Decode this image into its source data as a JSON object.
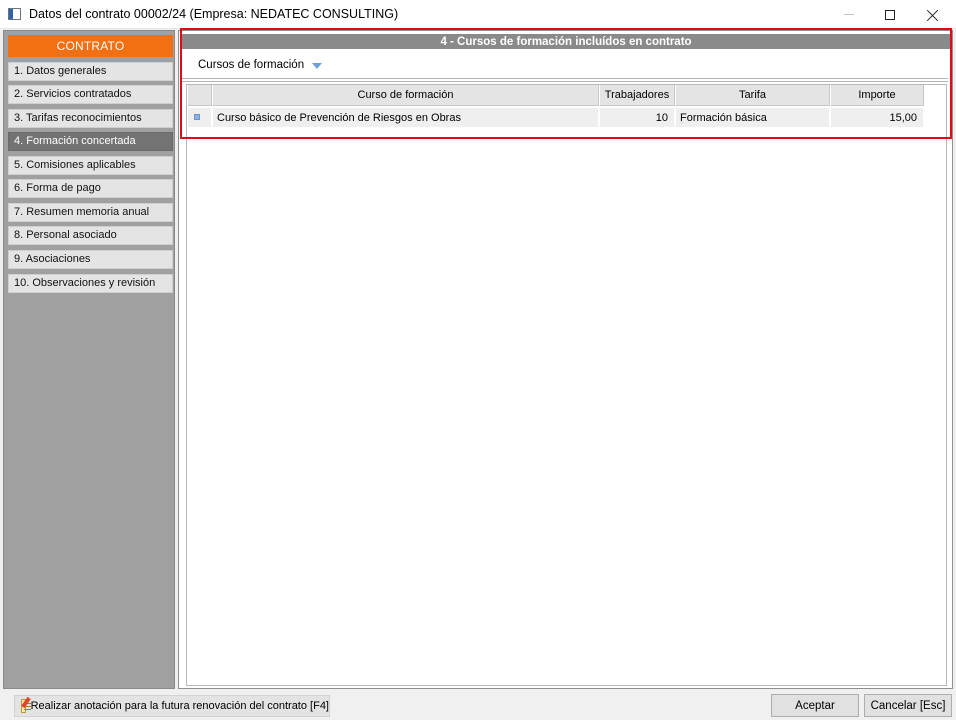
{
  "window": {
    "title": "Datos del contrato 00002/24  (Empresa: NEDATEC CONSULTING)"
  },
  "sidebar": {
    "header": "CONTRATO",
    "items": [
      {
        "label": "1. Datos generales",
        "active": false
      },
      {
        "label": "2. Servicios contratados",
        "active": false
      },
      {
        "label": "3. Tarifas reconocimientos",
        "active": false
      },
      {
        "label": "4. Formación concertada",
        "active": true
      },
      {
        "label": "5. Comisiones aplicables",
        "active": false
      },
      {
        "label": "6. Forma de pago",
        "active": false
      },
      {
        "label": "7. Resumen memoria anual",
        "active": false
      },
      {
        "label": "8. Personal asociado",
        "active": false
      },
      {
        "label": "9. Asociaciones",
        "active": false
      },
      {
        "label": "10. Observaciones y revisión",
        "active": false
      }
    ]
  },
  "section": {
    "title": "4 - Cursos de formación incluídos en contrato",
    "subsection": "Cursos de formación"
  },
  "table": {
    "columns": [
      "Curso de formación",
      "Trabajadores",
      "Tarifa",
      "Importe"
    ],
    "rows": [
      {
        "curso": "Curso básico de Prevención de Riesgos en Obras",
        "trabajadores": "10",
        "tarifa": "Formación básica",
        "importe": "15,00"
      }
    ]
  },
  "footer": {
    "note_button": "Realizar anotación para la futura renovación del contrato  [F4]",
    "accept": "Aceptar",
    "cancel": "Cancelar  [Esc]"
  },
  "colors": {
    "accent_orange": "#f26f12",
    "active_item": "#737373",
    "highlight_border": "#e10b17",
    "section_band": "#8a8a8a"
  }
}
